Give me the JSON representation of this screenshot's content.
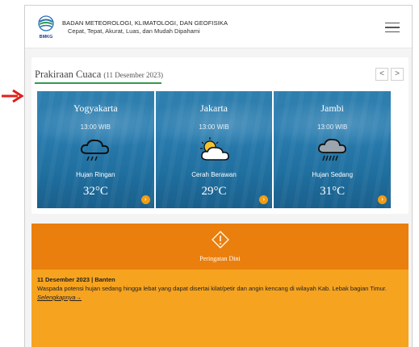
{
  "header": {
    "org_name": "BADAN METEOROLOGI, KLIMATOLOGI, DAN GEOFISIKA",
    "tagline": "Cepat, Tepat, Akurat, Luas, dan Mudah Dipahami",
    "logo_text": "BMKG"
  },
  "forecast": {
    "title": "Prakiraan Cuaca",
    "date": "(11 Desember 2023)",
    "prev_label": "<",
    "next_label": ">",
    "cards": [
      {
        "city": "Yogyakarta",
        "time": "13:00 WIB",
        "condition": "Hujan Ringan",
        "temp": "32°C",
        "icon": "light-rain-icon"
      },
      {
        "city": "Jakarta",
        "time": "13:00 WIB",
        "condition": "Cerah Berawan",
        "temp": "29°C",
        "icon": "partly-cloudy-icon"
      },
      {
        "city": "Jambi",
        "time": "13:00 WIB",
        "condition": "Hujan Sedang",
        "temp": "31°C",
        "icon": "moderate-rain-icon"
      }
    ]
  },
  "warning": {
    "label": "Peringatan Dini",
    "date_region": "11 Desember 2023 | Banten",
    "text": "Waspada potensi hujan sedang hingga lebat yang dapat disertai kilat/petir dan angin kencang di wilayah Kab. Lebak bagian Timur. ",
    "link": "Selengkapnya→"
  },
  "colors": {
    "accent_green": "#2e9b50",
    "warning_dark": "#ea7f0d",
    "warning_light": "#f6a320",
    "card_blue": "#2a7db0"
  }
}
